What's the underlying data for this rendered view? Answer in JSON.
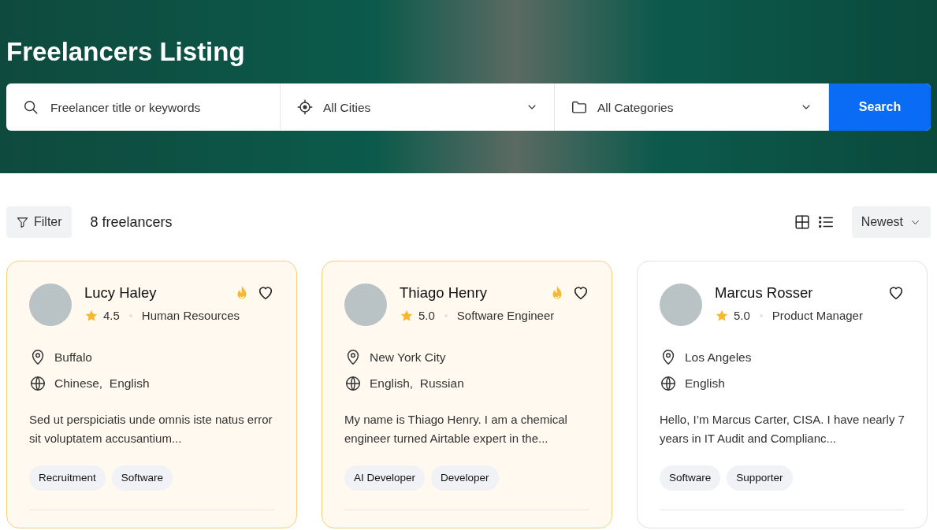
{
  "hero": {
    "title": "Freelancers Listing",
    "search": {
      "keywords_placeholder": "Freelancer title or keywords",
      "city": "All Cities",
      "category": "All Categories",
      "button": "Search"
    }
  },
  "toolbar": {
    "filter": "Filter",
    "count": "8 freelancers",
    "sort": "Newest"
  },
  "freelancers": [
    {
      "name": "Lucy Haley",
      "rating": "4.5",
      "role": "Human Resources",
      "featured": true,
      "saved": false,
      "location": "Buffalo",
      "languages": "Chinese,  English",
      "description": "Sed ut perspiciatis unde omnis iste natus error sit voluptatem accusantium...",
      "tags": [
        "Recruitment",
        "Software"
      ]
    },
    {
      "name": "Thiago Henry",
      "rating": "5.0",
      "role": "Software Engineer",
      "featured": true,
      "saved": false,
      "location": "New York City",
      "languages": "English,  Russian",
      "description": "My name is Thiago Henry. I am a chemical engineer turned Airtable expert in the...",
      "tags": [
        "AI Developer",
        "Developer"
      ]
    },
    {
      "name": "Marcus Rosser",
      "rating": "5.0",
      "role": "Product Manager",
      "featured": false,
      "saved": false,
      "location": "Los Angeles",
      "languages": "English",
      "description": "Hello, I’m Marcus Carter, CISA. I have nearly 7  years in IT Audit and Complianc...",
      "tags": [
        "Software",
        "Supporter"
      ]
    }
  ]
}
